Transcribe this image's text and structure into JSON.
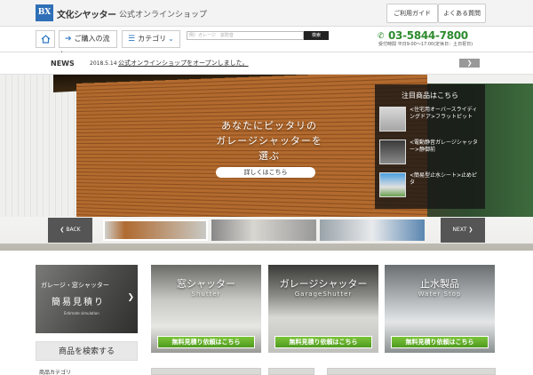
{
  "header": {
    "logo_mark": "BX",
    "logo_text": "文化シヤッター",
    "site_sub": "公式オンラインショップ",
    "guide_label": "ご利用ガイド",
    "faq_label": "よくある質問"
  },
  "nav": {
    "home_icon": "home-icon",
    "purchase_flow_label": "ご購入の流れ",
    "category_label": "カテゴリ",
    "search_placeholder": "例）ガレージ　窓防音",
    "search_button": "検索",
    "phone": "03-5844-7800",
    "hours": "受付時間 平日9:00～17:00(定休日：土日祝日)"
  },
  "news": {
    "label": "NEWS",
    "date": "2018.5.14",
    "text": "公式オンラインショップをオープンしました。"
  },
  "hero": {
    "copy_line1": "あなたにピッタリの",
    "copy_line2": "ガレージシャッターを",
    "copy_line3": "選ぶ",
    "cta": "詳しくはこちら",
    "back": "BACK",
    "next": "NEXT"
  },
  "featured": {
    "title": "注目商品はこちら",
    "items": [
      {
        "label": "<住宅用オーバースライディングドア>フラットピット"
      },
      {
        "label": "<電動静音ガレージシャッター>静御前"
      },
      {
        "label": "<簡易型止水シート>止めピタ"
      }
    ]
  },
  "sidebar": {
    "sim_line1": "ガレージ・窓シャッター",
    "sim_line2": "簡易見積り",
    "sim_line3": "Estimate simulation",
    "product_search": "商品を検索する",
    "category": "商品カテゴリ"
  },
  "cards": [
    {
      "title": "窓シャッター",
      "en": "Shutter",
      "cta": "無料見積り依頼はこちら"
    },
    {
      "title": "ガレージシャッター",
      "en": "GarageShutter",
      "cta": "無料見積り依頼はこちら"
    },
    {
      "title": "止水製品",
      "en": "Water Stop",
      "cta": "無料見積り依頼はこちら"
    }
  ],
  "colors": {
    "brand_blue": "#2f6fb7",
    "phone_green": "#2e8b2e",
    "cta_green": "#5fae2a"
  }
}
